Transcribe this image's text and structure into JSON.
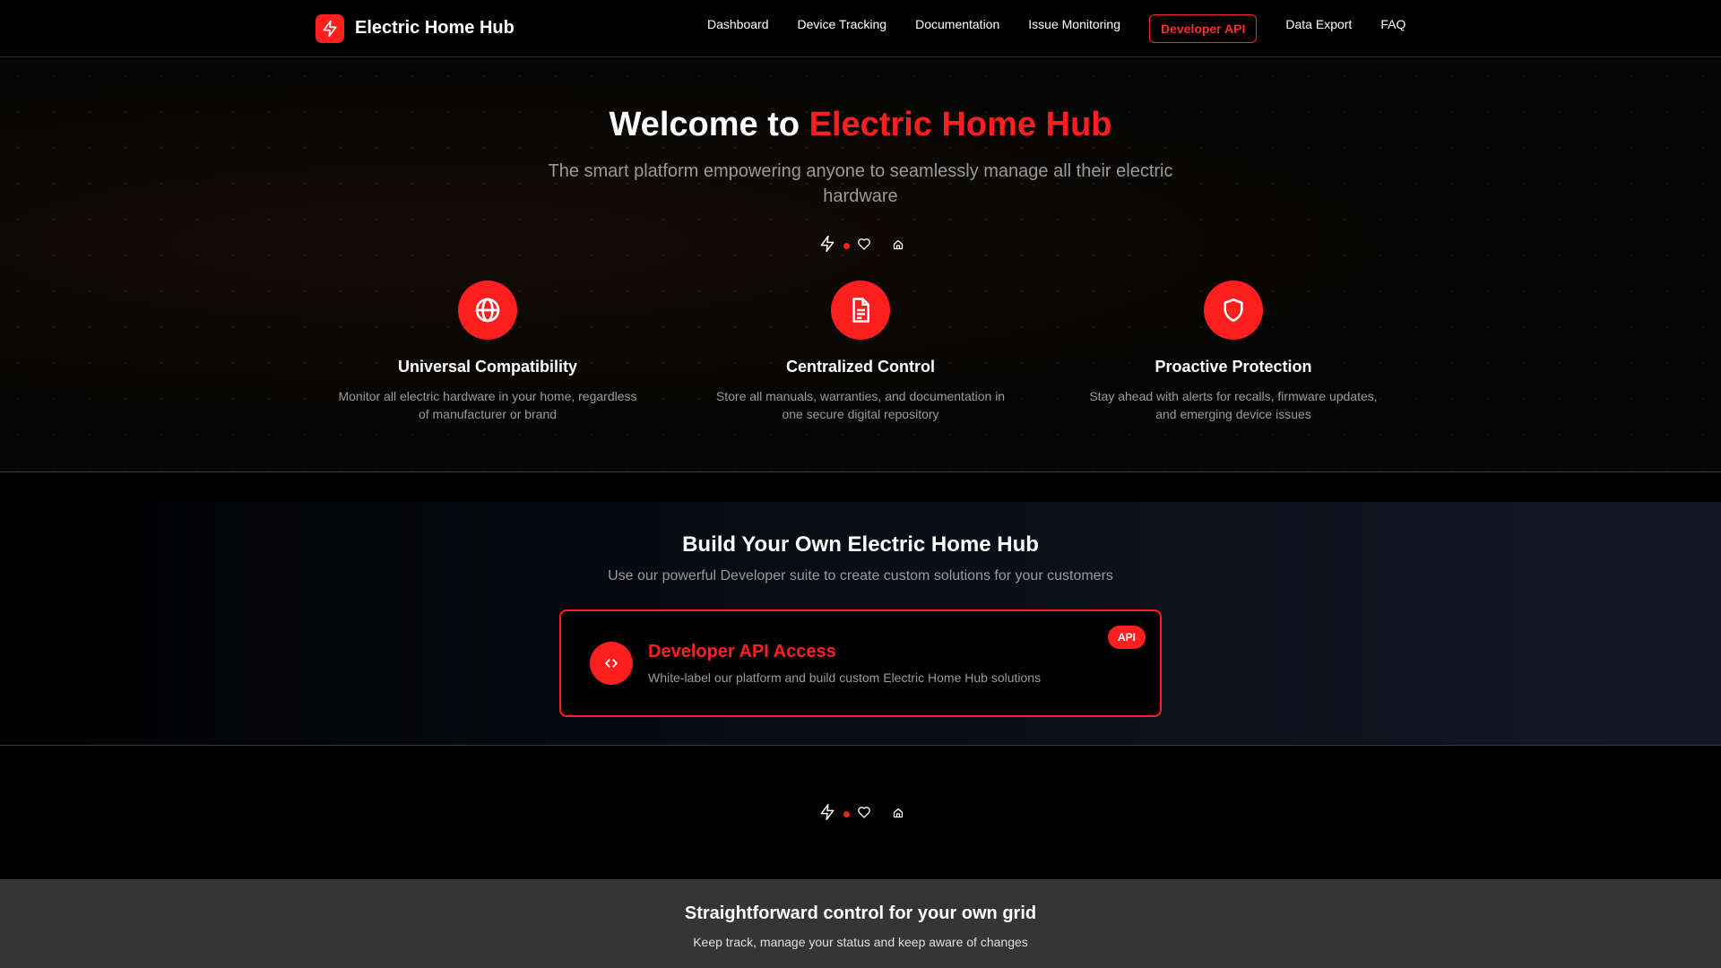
{
  "brand": {
    "name": "Electric Home Hub",
    "logo_icon": "lightning-icon",
    "accent_color": "#ff1f1f"
  },
  "nav": {
    "items": [
      {
        "label": "Dashboard"
      },
      {
        "label": "Device Tracking"
      },
      {
        "label": "Documentation"
      },
      {
        "label": "Issue Monitoring"
      },
      {
        "label": "Developer API",
        "active": true
      },
      {
        "label": "Data Export"
      },
      {
        "label": "FAQ"
      }
    ]
  },
  "hero": {
    "title_prefix": "Welcome to",
    "title_accent": "Electric Home Hub",
    "subtitle": "The smart platform empowering anyone to seamlessly manage all their electric hardware",
    "icon_strip": [
      "lightning-icon",
      "red-dot",
      "heart-icon",
      "home-icon"
    ]
  },
  "features": [
    {
      "icon": "globe-icon",
      "title": "Universal Compatibility",
      "description": "Monitor all electric hardware in your home, regardless of manufacturer or brand"
    },
    {
      "icon": "document-icon",
      "title": "Centralized Control",
      "description": "Store all manuals, warranties, and documentation in one secure digital repository"
    },
    {
      "icon": "shield-icon",
      "title": "Proactive Protection",
      "description": "Stay ahead with alerts for recalls, firmware updates, and emerging device issues"
    }
  ],
  "developer": {
    "title": "Build Your Own Electric Home Hub",
    "subtitle": "Use our powerful Developer suite to create custom solutions for your customers",
    "card": {
      "icon": "code-icon",
      "title": "Developer API Access",
      "description": "White-label our platform and build custom Electric Home Hub solutions",
      "badge": "API"
    }
  },
  "bottom": {
    "title": "Straightforward control for your own grid",
    "subtitle": "Keep track, manage your status and keep aware of changes"
  }
}
